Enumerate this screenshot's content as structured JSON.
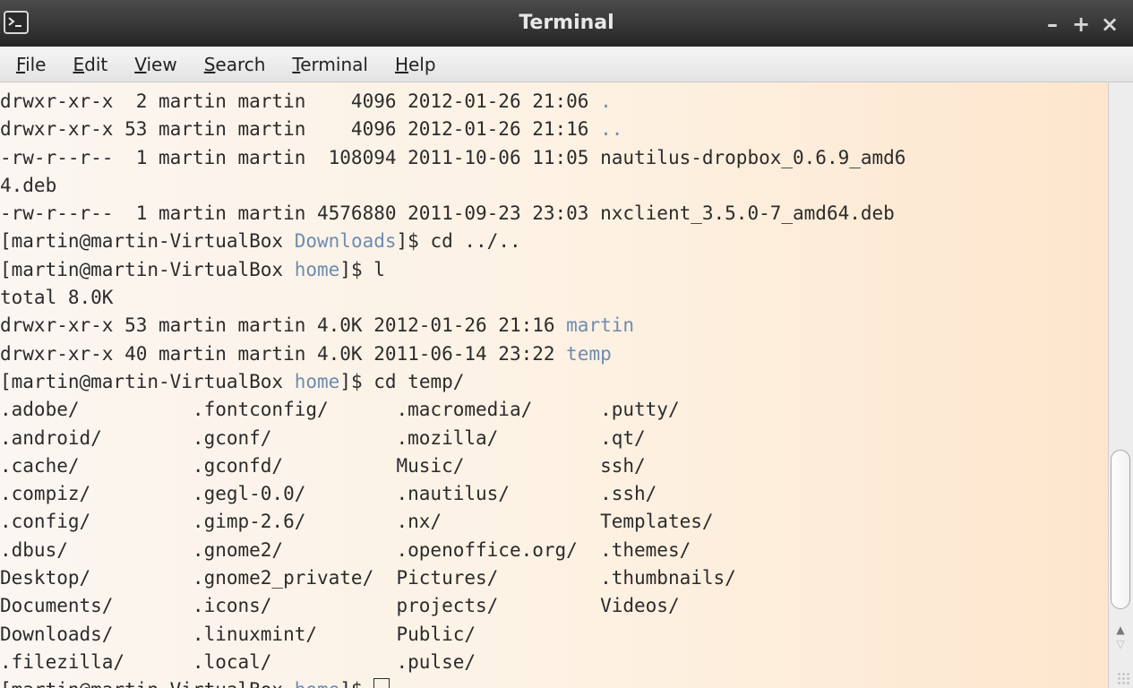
{
  "window": {
    "title": "Terminal",
    "buttons": {
      "minimize": "–",
      "maximize": "+",
      "close": "×"
    },
    "app_icon": "terminal-icon"
  },
  "menu": {
    "items": [
      {
        "mnemonic": "F",
        "rest": "ile"
      },
      {
        "mnemonic": "E",
        "rest": "dit"
      },
      {
        "mnemonic": "V",
        "rest": "iew"
      },
      {
        "mnemonic": "S",
        "rest": "earch"
      },
      {
        "mnemonic": "T",
        "rest": "erminal"
      },
      {
        "mnemonic": "H",
        "rest": "elp"
      }
    ]
  },
  "colors": {
    "directory_highlight": "#6d8cb0",
    "text": "#2b2b2b",
    "titlebar": "#333333"
  },
  "terminal": {
    "lines": [
      [
        {
          "t": "drwxr-xr-x  2 martin martin    4096 2012-01-26 21:06 "
        },
        {
          "t": ".",
          "hl": true
        }
      ],
      [
        {
          "t": "drwxr-xr-x 53 martin martin    4096 2012-01-26 21:16 "
        },
        {
          "t": "..",
          "hl": true
        }
      ],
      [
        {
          "t": "-rw-r--r--  1 martin martin  108094 2011-10-06 11:05 nautilus-dropbox_0.6.9_amd6"
        }
      ],
      [
        {
          "t": "4.deb"
        }
      ],
      [
        {
          "t": "-rw-r--r--  1 martin martin 4576880 2011-09-23 23:03 nxclient_3.5.0-7_amd64.deb"
        }
      ],
      [
        {
          "t": "[martin@martin-VirtualBox "
        },
        {
          "t": "Downloads",
          "hl": true
        },
        {
          "t": "]$ cd ../.."
        }
      ],
      [
        {
          "t": "[martin@martin-VirtualBox "
        },
        {
          "t": "home",
          "hl": true
        },
        {
          "t": "]$ l"
        }
      ],
      [
        {
          "t": "total 8.0K"
        }
      ],
      [
        {
          "t": "drwxr-xr-x 53 martin martin 4.0K 2012-01-26 21:16 "
        },
        {
          "t": "martin",
          "hl": true
        }
      ],
      [
        {
          "t": "drwxr-xr-x 40 martin martin 4.0K 2011-06-14 23:22 "
        },
        {
          "t": "temp",
          "hl": true
        }
      ],
      [
        {
          "t": "[martin@martin-VirtualBox "
        },
        {
          "t": "home",
          "hl": true
        },
        {
          "t": "]$ cd temp/"
        }
      ],
      [
        {
          "t": ".adobe/          .fontconfig/      .macromedia/      .putty/"
        }
      ],
      [
        {
          "t": ".android/        .gconf/           .mozilla/         .qt/"
        }
      ],
      [
        {
          "t": ".cache/          .gconfd/          Music/            ssh/"
        }
      ],
      [
        {
          "t": ".compiz/         .gegl-0.0/        .nautilus/        .ssh/"
        }
      ],
      [
        {
          "t": ".config/         .gimp-2.6/        .nx/              Templates/"
        }
      ],
      [
        {
          "t": ".dbus/           .gnome2/          .openoffice.org/  .themes/"
        }
      ],
      [
        {
          "t": "Desktop/         .gnome2_private/  Pictures/         .thumbnails/"
        }
      ],
      [
        {
          "t": "Documents/       .icons/           projects/         Videos/"
        }
      ],
      [
        {
          "t": "Downloads/       .linuxmint/       Public/"
        }
      ],
      [
        {
          "t": ".filezilla/      .local/           .pulse/"
        }
      ],
      [
        {
          "t": "[martin@martin-VirtualBox "
        },
        {
          "t": "home",
          "hl": true
        },
        {
          "t": "]$ "
        }
      ]
    ]
  },
  "scrollbar": {
    "up_icon": "arrow-up-icon",
    "down_icon": "arrow-down-icon",
    "up_glyph": "▲",
    "down_glyph": "▽"
  }
}
